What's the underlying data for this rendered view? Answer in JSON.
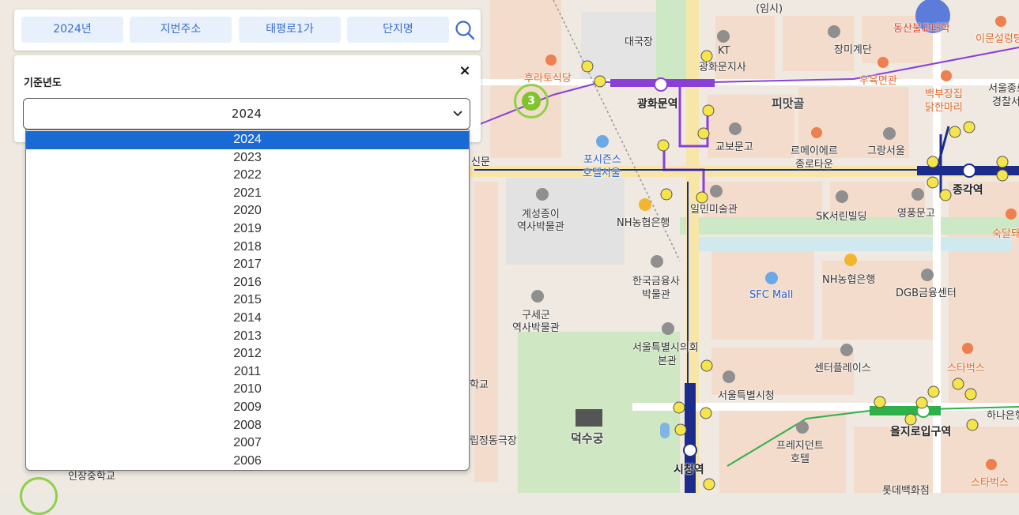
{
  "filters": [
    {
      "label": "2024년"
    },
    {
      "label": "지번주소"
    },
    {
      "label": "태평로1가"
    },
    {
      "label": "단지명"
    }
  ],
  "year_panel": {
    "title": "기준년도",
    "selected_value": "2024",
    "close_symbol": "×",
    "options": [
      "2024",
      "2023",
      "2022",
      "2021",
      "2020",
      "2019",
      "2018",
      "2017",
      "2016",
      "2015",
      "2014",
      "2013",
      "2012",
      "2011",
      "2010",
      "2009",
      "2008",
      "2007",
      "2006"
    ]
  },
  "map": {
    "cluster_count": "3",
    "labels": {
      "daegukjang": "대국장",
      "kt": "KT",
      "kt2": "광화문지사",
      "gwanghwamun": "광화문역",
      "pimatgol": "피맛골",
      "kyobo": "교보문고",
      "lemeiere": "르메이에르",
      "lemeiere2": "종로타운",
      "grangseoul": "그랑서울",
      "jonggak": "종각역",
      "fourseasons": "포시즌스",
      "fourseasons2": "호텔서울",
      "ilmin": "일민미술관",
      "nh1": "NH농협은행",
      "gyeseong": "계성종이",
      "gyeseong2": "역사박물관",
      "sk": "SK서린빌딩",
      "youngpung": "영풍문고",
      "bok": "한국금융사",
      "bok2": "박물관",
      "nh2": "NH농협은행",
      "sfc": "SFC Mall",
      "dgb": "DGB금융센터",
      "gusegun": "구세군",
      "gusegun2": "역사박물관",
      "council": "서울특별시의회",
      "council2": "본관",
      "centerplace": "센터플레이스",
      "cityhall": "서울특별시청",
      "starbucks1": "스타벅스",
      "starbucks2": "스타벅스",
      "deoksugung": "덕수궁",
      "president": "프레지던트",
      "president2": "호텔",
      "euljiro": "을지로입구역",
      "cityhallstn": "시청역",
      "lotte": "롯데백화점",
      "hana": "하나은행",
      "jangmi": "장미계단",
      "uyukmyeon": "우육면관",
      "baekbu": "백부장집",
      "baekbu2": "닭한마리",
      "imun": "이문설렁탕",
      "police": "서울종로",
      "police2": "경찰서",
      "hura": "후라토식당",
      "sukdal": "숙달돼지",
      "dongsan": "동산불교대학",
      "imsi": "(임시)",
      "sinmun": "신문",
      "jeongdong": "립정동극장",
      "injang": "인장중학교",
      "hakgyo": "학교"
    }
  },
  "colors": {
    "filter_bg": "#e8f0fc",
    "filter_text": "#3a6ed2",
    "selected_option_bg": "#1a6ad6",
    "line1": "#1c2c8c",
    "line2": "#2fb14a",
    "line5": "#8a3fd6",
    "cluster": "#7fc42b"
  }
}
